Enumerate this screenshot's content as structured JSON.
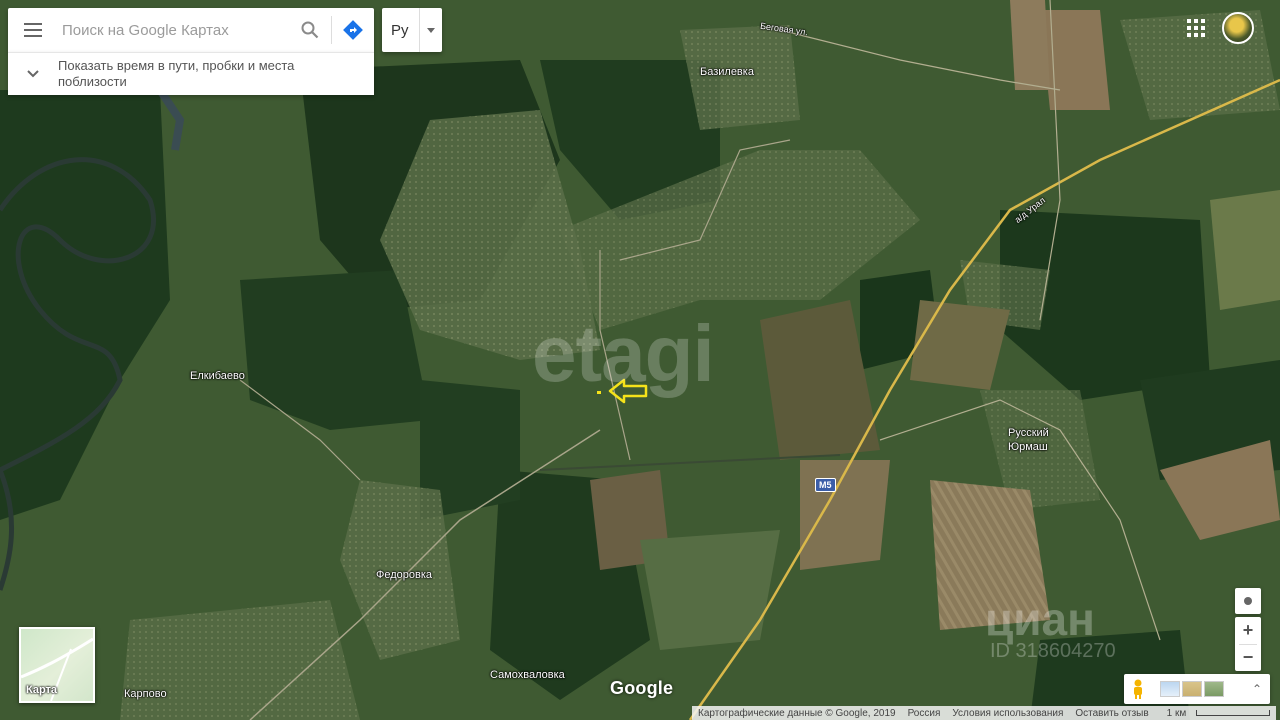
{
  "search": {
    "placeholder": "Поиск на Google Картах"
  },
  "traffic_panel": {
    "text": "Показать время в пути, пробки и места поблизости"
  },
  "language": {
    "label": "Ру"
  },
  "minimap": {
    "label": "Карта"
  },
  "map": {
    "labels": {
      "bazilevka": "Базилевка",
      "begovaya": "Беговая ул.",
      "elkibaevo": "Елкибаево",
      "fedorovka": "Федоровка",
      "samokhvalovka": "Самохваловка",
      "karpovo": "Карпово",
      "russkiy_yurmash": "Русский Юрмаш",
      "ural_road": "а/д Урал",
      "m5": "M5"
    },
    "watermarks": {
      "etagi": "etagi",
      "cian": "циан",
      "id": "ID 318604270"
    }
  },
  "controls": {
    "zoom_in": "+",
    "zoom_out": "−",
    "expand": "⌃"
  },
  "branding": {
    "google": "Google"
  },
  "footer": {
    "copyright": "Картографические данные © Google, 2019",
    "country": "Россия",
    "terms": "Условия использования",
    "feedback": "Оставить отзыв",
    "scale": "1 км"
  },
  "colors": {
    "forest": "#1f3a1e",
    "field": "#556b3a",
    "highway": "#e6c34a",
    "marker": "#f5e21a"
  }
}
